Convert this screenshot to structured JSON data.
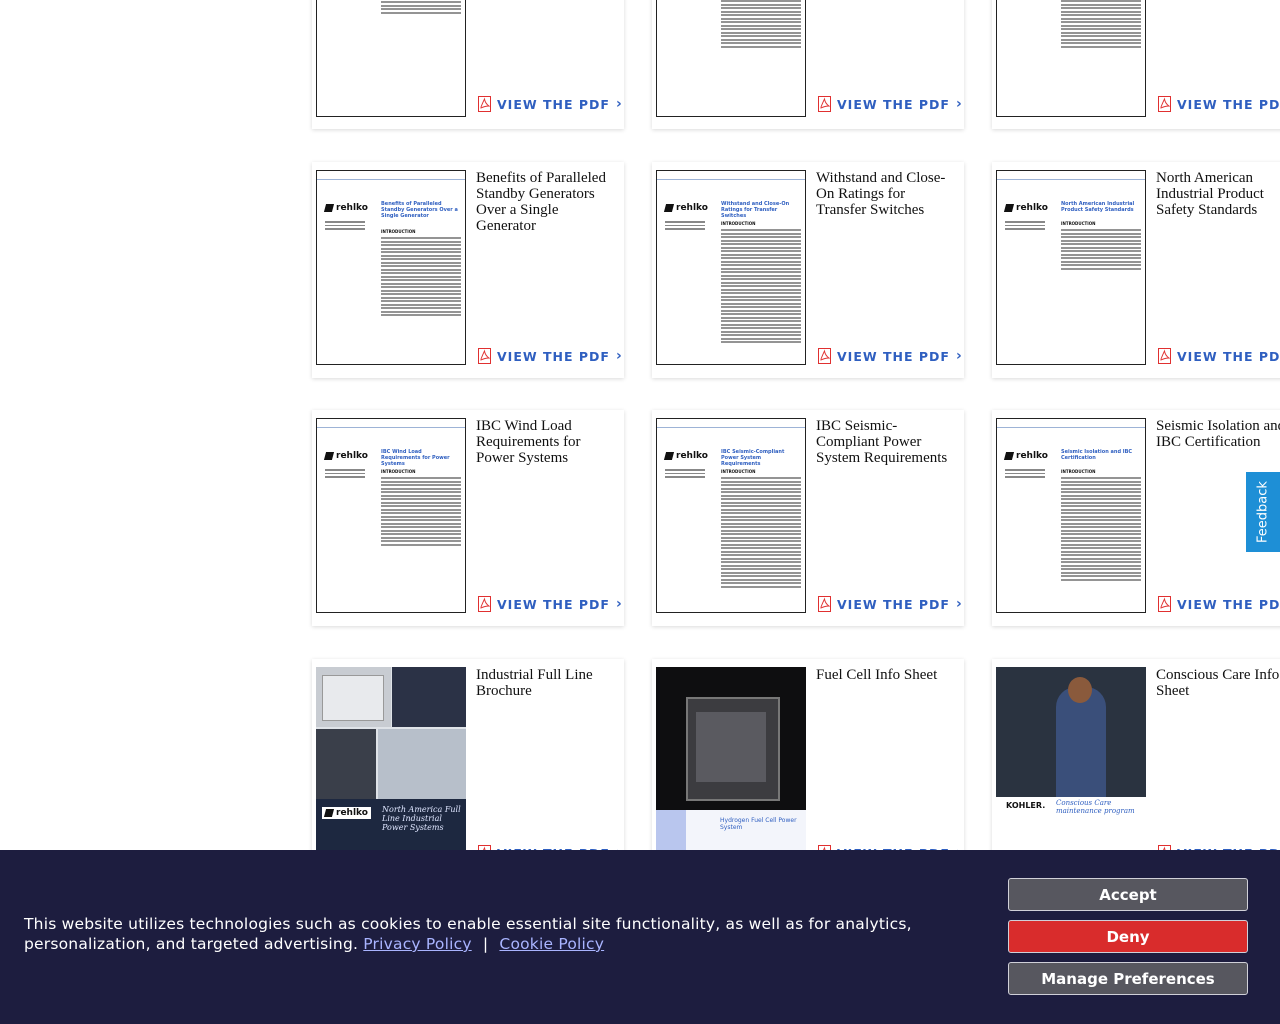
{
  "cards": [
    {
      "title": "",
      "link": "VIEW THE PDF"
    },
    {
      "title": "",
      "link": "VIEW THE PDF"
    },
    {
      "title": "",
      "link": "VIEW THE PDF"
    },
    {
      "title": "Benefits of Paralleled Standby Generators Over a Single Generator",
      "link": "VIEW THE PDF",
      "doc_heading": "Benefits of Paralleled Standby Generators Over a Single Generator"
    },
    {
      "title": "Withstand and Close-On Ratings for Transfer Switches",
      "link": "VIEW THE PDF",
      "doc_heading": "Withstand and Close-On Ratings for Transfer Switches"
    },
    {
      "title": "North American Industrial Product Safety Standards",
      "link": "VIEW THE PDF",
      "doc_heading": "North American Industrial Product Safety Standards"
    },
    {
      "title": "IBC Wind Load Requirements for Power Systems",
      "link": "VIEW THE PDF",
      "doc_heading": "IBC Wind Load Requirements for Power Systems"
    },
    {
      "title": "IBC Seismic-Compliant Power System Requirements",
      "link": "VIEW THE PDF",
      "doc_heading": "IBC Seismic-Compliant Power System Requirements"
    },
    {
      "title": "Seismic Isolation and IBC Certification",
      "link": "VIEW THE PDF",
      "doc_heading": "Seismic Isolation and IBC Certification"
    },
    {
      "title": "Industrial Full Line Brochure",
      "link": "VIEW THE PDF",
      "brochure_text": "North America Full Line Industrial Power Systems"
    },
    {
      "title": "Fuel Cell Info Sheet",
      "link": "VIEW THE PDF",
      "brochure_text": "Hydrogen Fuel Cell Power System"
    },
    {
      "title": "Conscious Care Info Sheet",
      "link": "VIEW THE PDF",
      "brochure_text": "Conscious Care maintenance program"
    }
  ],
  "doc_labels": {
    "logo": "rehlko",
    "intro": "INTRODUCTION",
    "kohler": "KOHLER."
  },
  "feedback": "Feedback",
  "cookie": {
    "text": "This website utilizes technologies such as cookies to enable essential site functionality, as well as for analytics, personalization, and targeted advertising.",
    "privacy": "Privacy Policy",
    "separator": "|",
    "cookie_policy": "Cookie Policy",
    "accept": "Accept",
    "deny": "Deny",
    "manage": "Manage Preferences"
  },
  "colors": {
    "link": "#2f5fc0",
    "banner": "#1d1d3f",
    "deny": "#d92c2c",
    "feedback": "#1e8fd6"
  },
  "icons": {
    "pdf": "pdf-file-icon",
    "chevron": "chevron-right-icon"
  }
}
